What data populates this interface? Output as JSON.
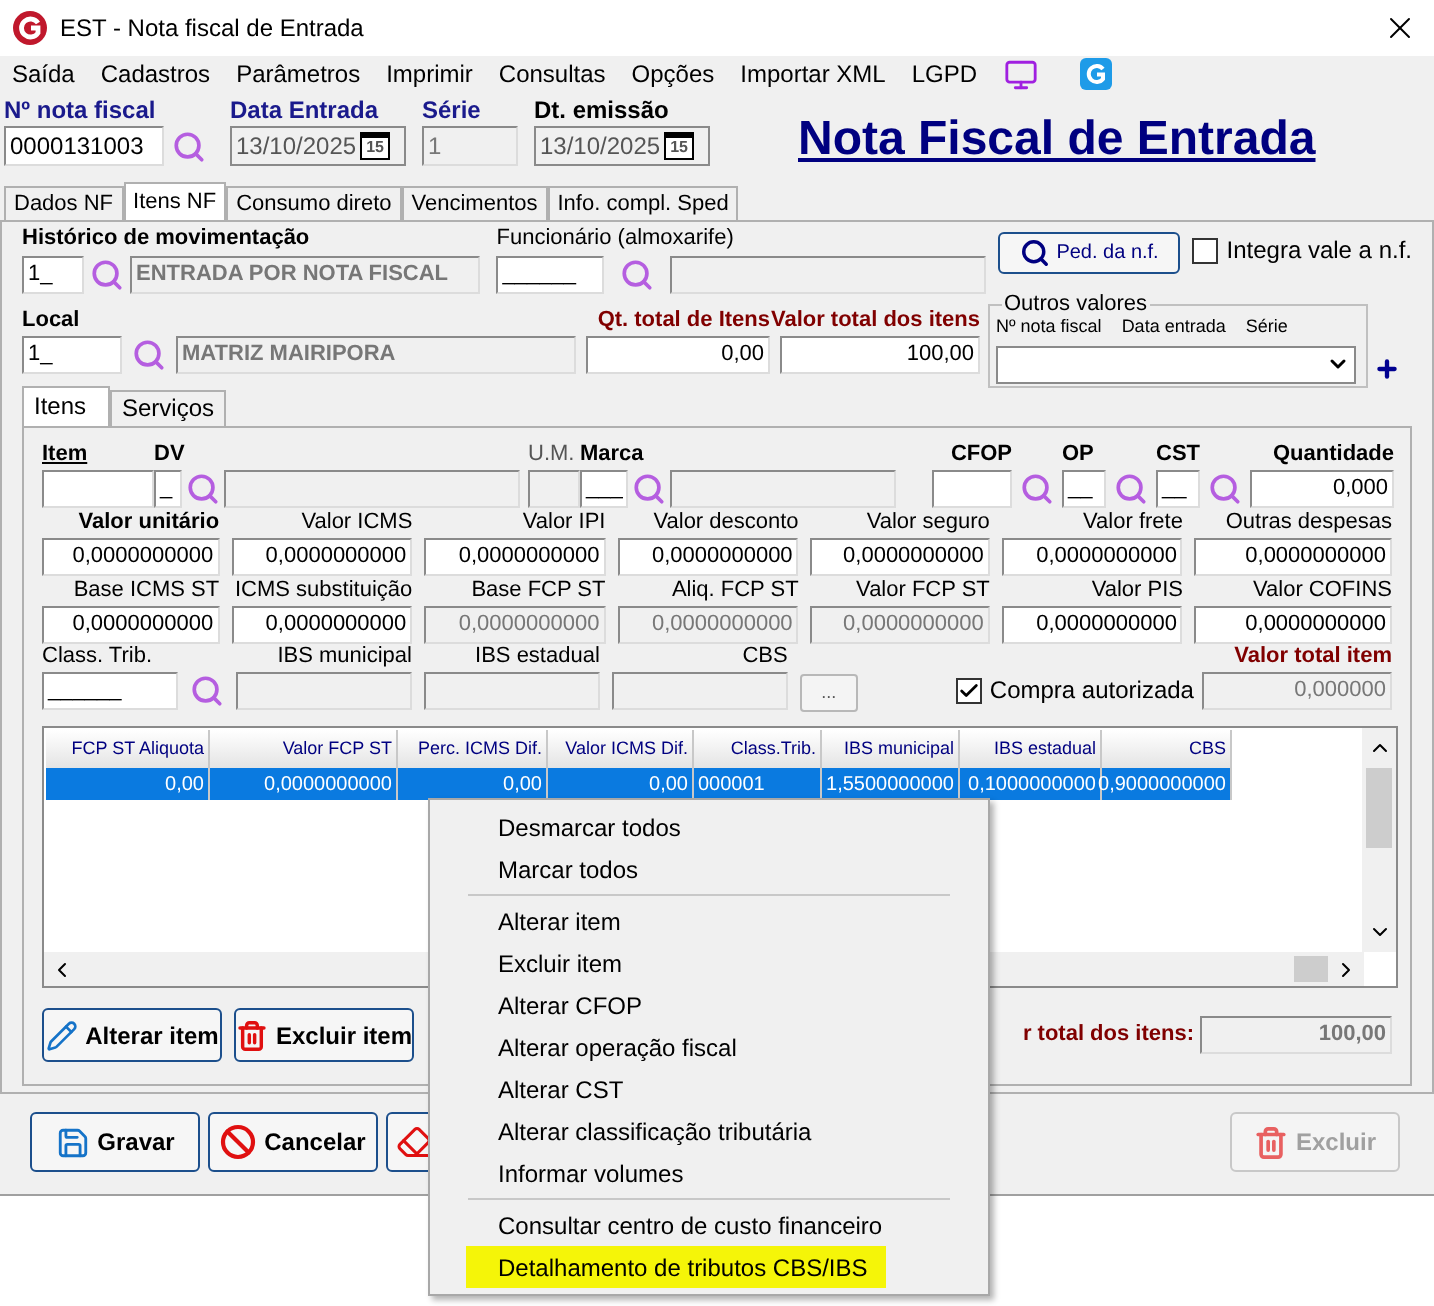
{
  "window": {
    "title": "EST - Nota fiscal de Entrada"
  },
  "menu": [
    {
      "label": "Saída"
    },
    {
      "label": "Cadastros"
    },
    {
      "label": "Parâmetros"
    },
    {
      "label": "Imprimir"
    },
    {
      "label": "Consultas"
    },
    {
      "label": "Opções"
    },
    {
      "label": "Importar XML"
    },
    {
      "label": "LGPD"
    }
  ],
  "header": {
    "fields": [
      {
        "label": "Nº nota fiscal",
        "value": "0000131003",
        "kind": "search"
      },
      {
        "label": "Data Entrada",
        "value": "13/10/2025",
        "kind": "date",
        "icon_text": "15"
      },
      {
        "label": "Série",
        "value": "1",
        "kind": "plain"
      },
      {
        "label": "Dt. emissão",
        "value": "13/10/2025",
        "kind": "date",
        "icon_text": "15"
      }
    ],
    "title": "Nota Fiscal de Entrada"
  },
  "tabs": [
    {
      "label": "Dados NF",
      "selected": false
    },
    {
      "label": "Itens NF",
      "selected": true
    },
    {
      "label": "Consumo direto",
      "selected": false
    },
    {
      "label": "Vencimentos",
      "selected": false
    },
    {
      "label": "Info. compl. Sped",
      "selected": false
    }
  ],
  "historico": {
    "label": "Histórico de movimentação",
    "code": "1_",
    "description": "ENTRADA POR NOTA FISCAL"
  },
  "funcionario": {
    "label": "Funcionário (almoxarife)",
    "code": "______"
  },
  "ped_button": "Ped. da n.f.",
  "integra": {
    "label": "Integra vale a n.f.",
    "checked": false
  },
  "local": {
    "label": "Local",
    "code": "1_",
    "description": "MATRIZ MAIRIPORA"
  },
  "totals": [
    {
      "label": "Qt. total de Itens",
      "value": "0,00"
    },
    {
      "label": "Valor total dos itens",
      "value": "100,00"
    }
  ],
  "outros_valores": {
    "title": "Outros valores",
    "columns": [
      "Nº nota fiscal",
      "Data entrada",
      "Série"
    ]
  },
  "subtabs": [
    {
      "label": "Itens",
      "selected": true
    },
    {
      "label": "Serviços",
      "selected": false
    }
  ],
  "item_fields": [
    {
      "label": "Item"
    },
    {
      "label": "DV",
      "value": "_"
    },
    {
      "label": "U.M."
    },
    {
      "label": "Marca",
      "value": "___"
    },
    {
      "label": "CFOP"
    },
    {
      "label": "OP",
      "value": "__"
    },
    {
      "label": "CST",
      "value": "__"
    },
    {
      "label": "Quantidade",
      "value": "0,000"
    }
  ],
  "value_rows": [
    [
      {
        "label": "Valor unitário",
        "value": "0,0000000000",
        "bold": true,
        "disabled": false
      },
      {
        "label": "Valor ICMS",
        "value": "0,0000000000",
        "bold": false,
        "disabled": false
      },
      {
        "label": "Valor IPI",
        "value": "0,0000000000",
        "bold": false,
        "disabled": false
      },
      {
        "label": "Valor desconto",
        "value": "0,0000000000",
        "bold": false,
        "disabled": false
      },
      {
        "label": "Valor seguro",
        "value": "0,0000000000",
        "bold": false,
        "disabled": false
      },
      {
        "label": "Valor frete",
        "value": "0,0000000000",
        "bold": false,
        "disabled": false
      },
      {
        "label": "Outras despesas",
        "value": "0,0000000000",
        "bold": false,
        "disabled": false
      }
    ],
    [
      {
        "label": "Base ICMS ST",
        "value": "0,0000000000",
        "bold": false,
        "disabled": false
      },
      {
        "label": "ICMS substituição",
        "value": "0,0000000000",
        "bold": false,
        "disabled": false
      },
      {
        "label": "Base FCP ST",
        "value": "0,0000000000",
        "bold": false,
        "disabled": true
      },
      {
        "label": "Aliq. FCP ST",
        "value": "0,0000000000",
        "bold": false,
        "disabled": true
      },
      {
        "label": "Valor FCP ST",
        "value": "0,0000000000",
        "bold": false,
        "disabled": true
      },
      {
        "label": "Valor PIS",
        "value": "0,0000000000",
        "bold": false,
        "disabled": false
      },
      {
        "label": "Valor COFINS",
        "value": "0,0000000000",
        "bold": false,
        "disabled": false
      }
    ]
  ],
  "tax_row": {
    "class_trib": {
      "label": "Class. Trib.",
      "value": "______"
    },
    "fields": [
      {
        "label": "IBS municipal"
      },
      {
        "label": "IBS estadual"
      },
      {
        "label": "CBS"
      }
    ],
    "more_button": "...",
    "compra": {
      "label": "Compra autorizada",
      "checked": true
    },
    "total": {
      "label": "Valor total item",
      "value": "0,000000"
    }
  },
  "grid": {
    "columns": [
      "FCP ST Aliquota",
      "Valor FCP ST",
      "Perc. ICMS Dif.",
      "Valor ICMS Dif.",
      "Class.Trib.",
      "IBS municipal",
      "IBS estadual",
      "CBS"
    ],
    "rows": [
      {
        "cells": [
          "0,00",
          "0,0000000000",
          "0,00",
          "0,00",
          "000001",
          "1,5500000000",
          "0,1000000000",
          "0,9000000000"
        ],
        "selected": true
      }
    ]
  },
  "item_buttons": [
    {
      "label": "Alterar item",
      "kind": "edit"
    },
    {
      "label": "Excluir item",
      "kind": "delete"
    }
  ],
  "items_total": {
    "label": "r total dos itens:",
    "value": "100,00"
  },
  "footer_buttons": [
    {
      "label": "Gravar",
      "kind": "save",
      "disabled": false
    },
    {
      "label": "Cancelar",
      "kind": "cancel",
      "disabled": false
    },
    {
      "kind": "erase",
      "disabled": false
    },
    {
      "label": "Excluir",
      "kind": "delete",
      "disabled": true
    }
  ],
  "context_menu": [
    {
      "kind": "item",
      "label": "Desmarcar todos",
      "selected": false
    },
    {
      "kind": "item",
      "label": "Marcar todos",
      "selected": false
    },
    {
      "kind": "separator"
    },
    {
      "kind": "item",
      "label": "Alterar item",
      "selected": false
    },
    {
      "kind": "item",
      "label": "Excluir item",
      "selected": false
    },
    {
      "kind": "item",
      "label": "Alterar CFOP",
      "selected": false
    },
    {
      "kind": "item",
      "label": "Alterar operação fiscal",
      "selected": false
    },
    {
      "kind": "item",
      "label": "Alterar CST",
      "selected": false
    },
    {
      "kind": "item",
      "label": "Alterar classificação tributária",
      "selected": false
    },
    {
      "kind": "item",
      "label": "Informar volumes",
      "selected": false
    },
    {
      "kind": "separator"
    },
    {
      "kind": "item",
      "label": "Consultar centro de custo financeiro",
      "selected": false
    },
    {
      "kind": "item",
      "label": "Detalhamento de tributos CBS/IBS",
      "selected": true
    }
  ]
}
